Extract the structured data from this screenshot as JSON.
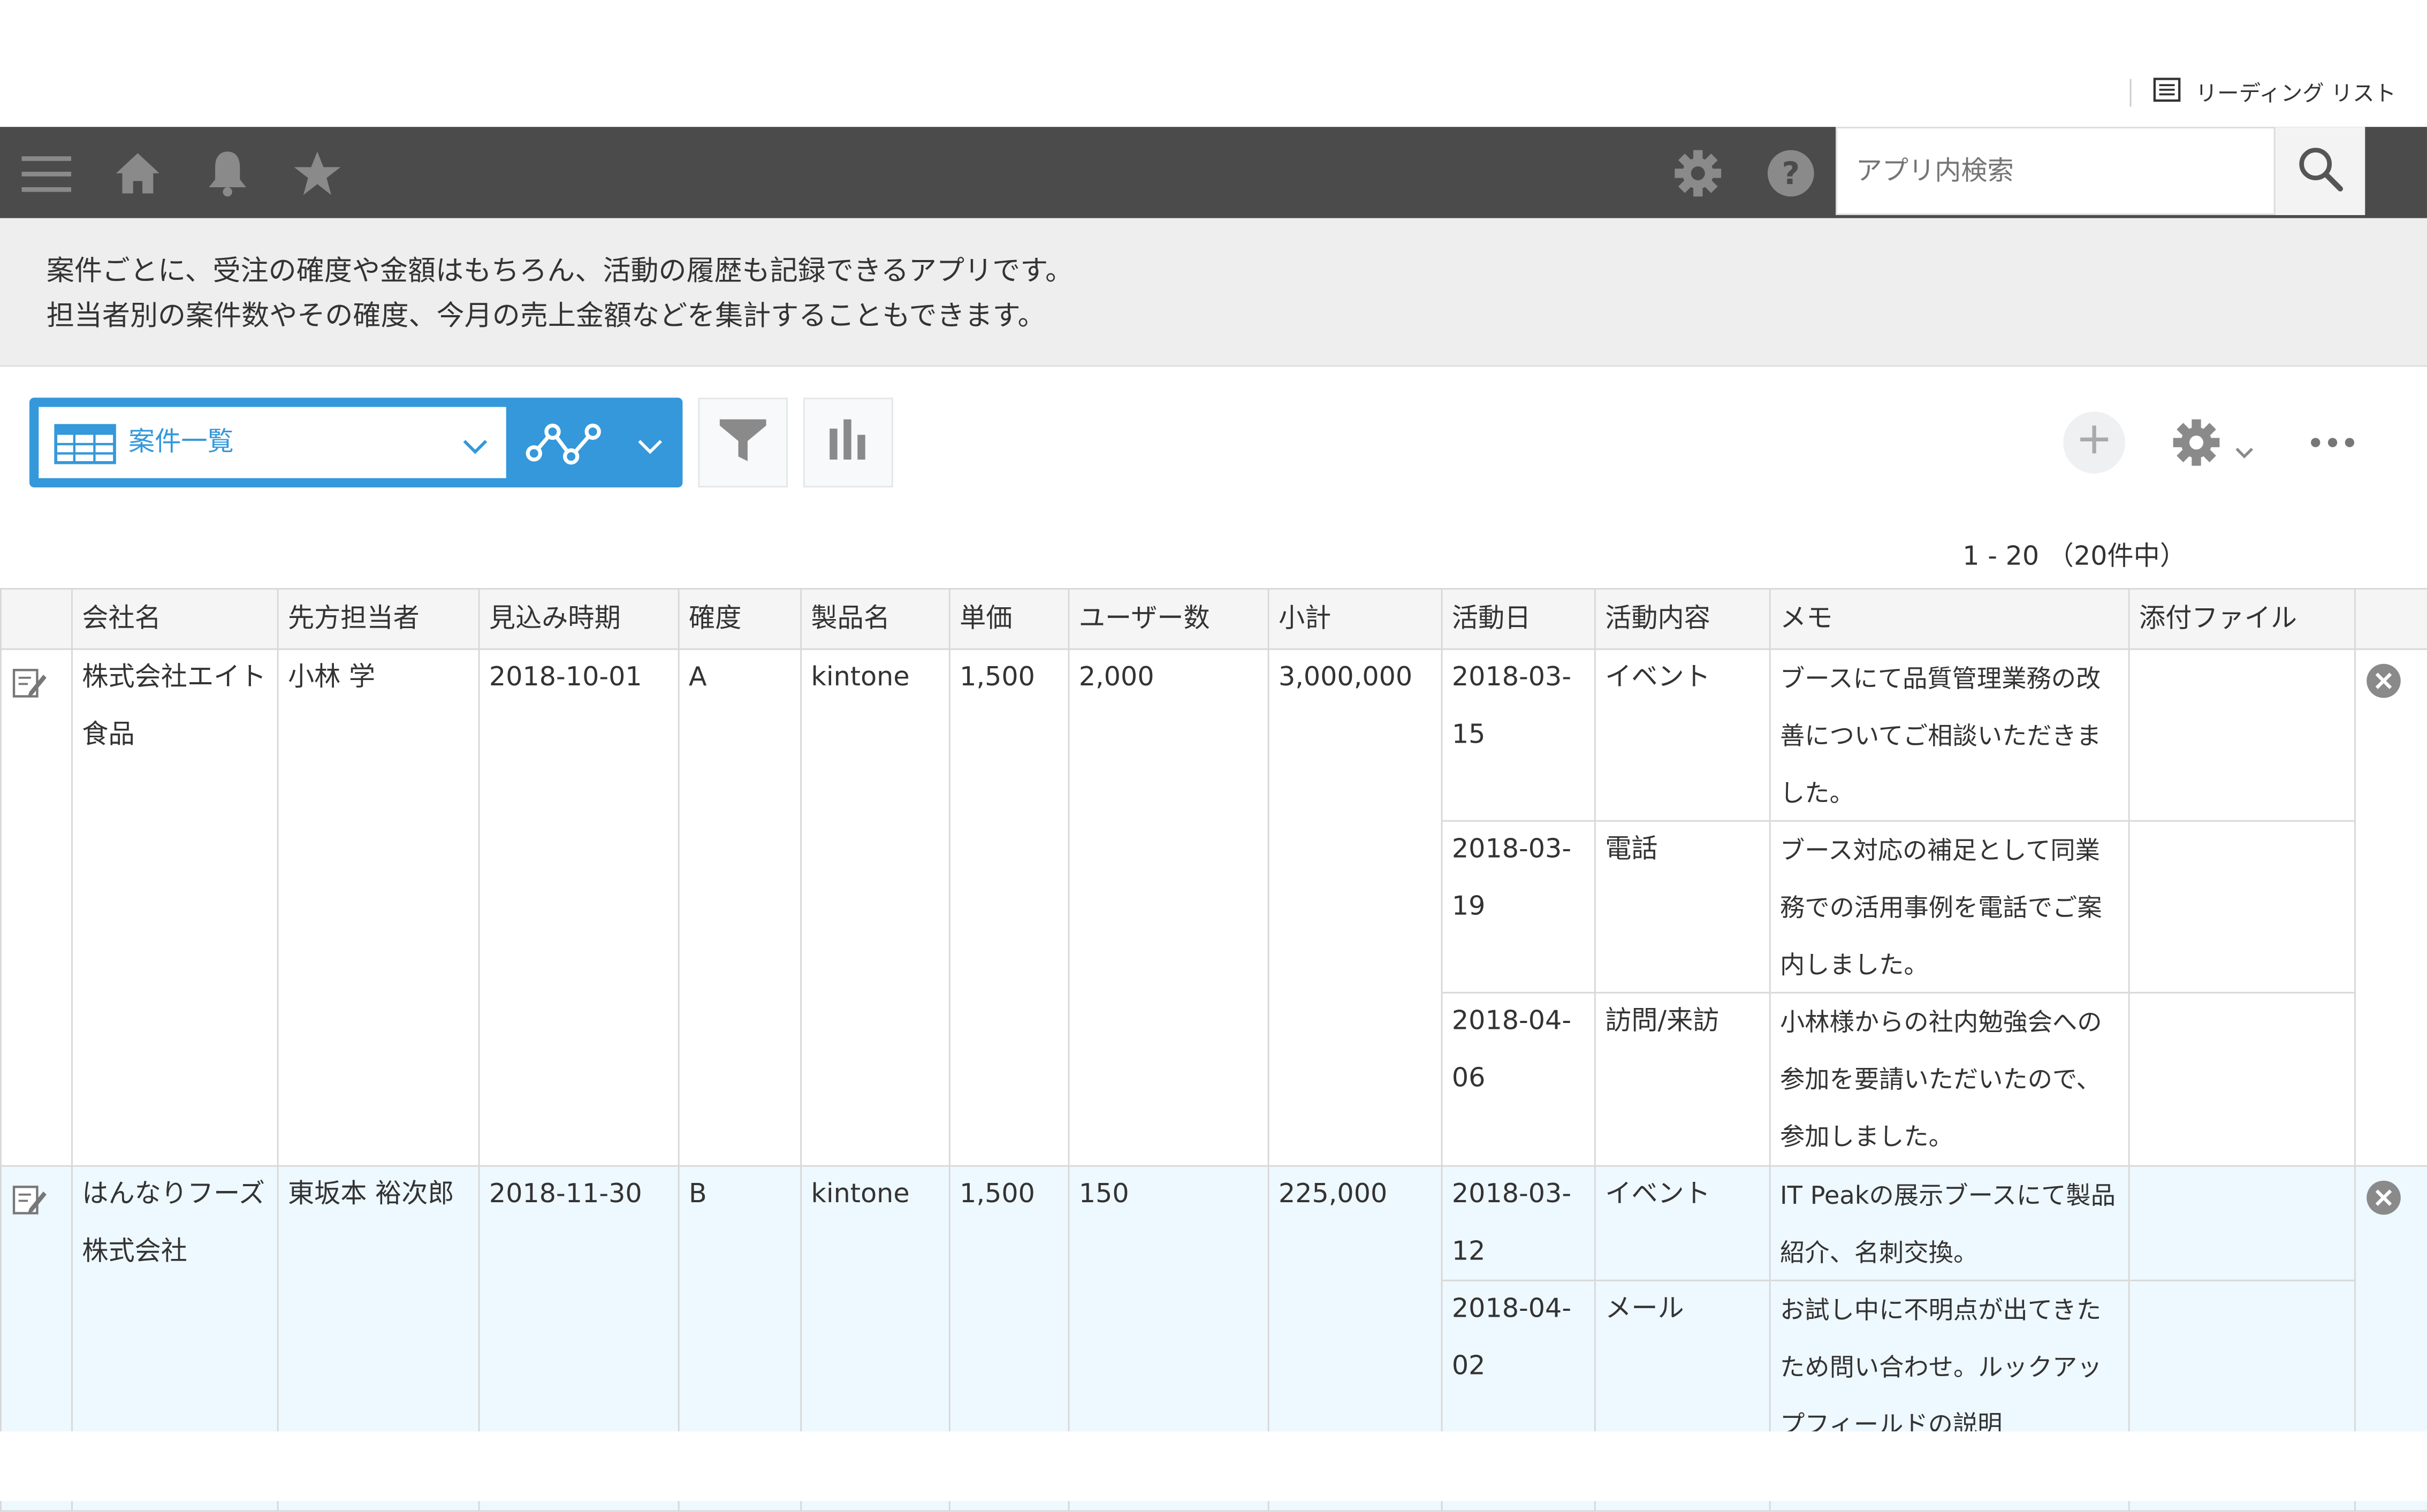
{
  "browser": {
    "reading_list_label": "リーディング リスト"
  },
  "search": {
    "placeholder": "アプリ内検索"
  },
  "description": {
    "line1": "案件ごとに、受注の確度や金額はもちろん、活動の履歴も記録できるアプリです。",
    "line2": "担当者別の案件数やその確度、今月の売上金額などを集計することもできます。"
  },
  "view": {
    "selected": "案件一覧"
  },
  "pagination": {
    "label": "1 - 20 （20件中）"
  },
  "table": {
    "columns": [
      "会社名",
      "先方担当者",
      "見込み時期",
      "確度",
      "製品名",
      "単価",
      "ユーザー数",
      "小計",
      "活動日",
      "活動内容",
      "メモ",
      "添付ファイル"
    ],
    "records": [
      {
        "company": "株式会社エイト食品",
        "contact": "小林 学",
        "expected": "2018-10-01",
        "confidence": "A",
        "product": "kintone",
        "unit_price": "1,500",
        "users": "2,000",
        "subtotal": "3,000,000",
        "activities": [
          {
            "date": "2018-03-15",
            "type": "イベント",
            "memo": "ブースにて品質管理業務の改善についてご相談いただきました。"
          },
          {
            "date": "2018-03-19",
            "type": "電話",
            "memo": "ブース対応の補足として同業務での活用事例を電話でご案内しました。"
          },
          {
            "date": "2018-04-06",
            "type": "訪問/来訪",
            "memo": "小林様からの社内勉強会への参加を要請いただいたので、参加しました。"
          }
        ]
      },
      {
        "company": "はんなりフーズ株式会社",
        "contact": "東坂本 裕次郎",
        "expected": "2018-11-30",
        "confidence": "B",
        "product": "kintone",
        "unit_price": "1,500",
        "users": "150",
        "subtotal": "225,000",
        "activities": [
          {
            "date": "2018-03-12",
            "type": "イベント",
            "memo": "IT Peakの展示ブースにて製品紹介、名刺交換。"
          },
          {
            "date": "2018-04-02",
            "type": "メール",
            "memo": "お試し中に不明点が出てきたため問い合わせ。ルックアップフィールドの説明"
          }
        ]
      }
    ]
  }
}
